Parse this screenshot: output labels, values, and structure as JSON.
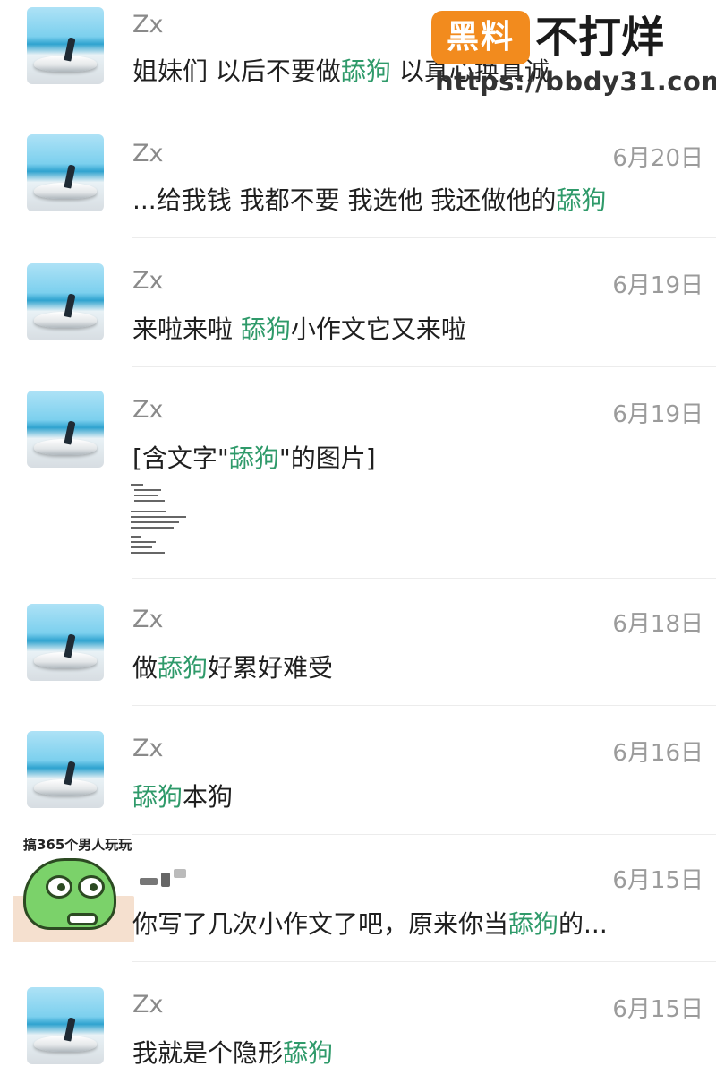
{
  "conversations": [
    {
      "name": "Zx",
      "date": "",
      "pre": "姐妹们 以后不要做",
      "kw": "舔狗",
      "post": " 以真心换真诚"
    },
    {
      "name": "Zx",
      "date": "6月20日",
      "pre": "...给我钱 我都不要 我选他 我还做他的",
      "kw": "舔狗",
      "post": ""
    },
    {
      "name": "Zx",
      "date": "6月19日",
      "pre": "来啦来啦 ",
      "kw": "舔狗",
      "post": "小作文它又来啦"
    },
    {
      "name": "Zx",
      "date": "6月19日",
      "pre": "[含文字\"",
      "kw": "舔狗",
      "post": "\"的图片]"
    },
    {
      "name": "Zx",
      "date": "6月18日",
      "pre": "做",
      "kw": "舔狗",
      "post": "好累好难受"
    },
    {
      "name": "Zx",
      "date": "6月16日",
      "pre": "",
      "kw": "舔狗",
      "post": "本狗"
    },
    {
      "name": "",
      "date": "6月15日",
      "pre": "你写了几次小作文了吧，原来你当",
      "kw": "舔狗",
      "post": "的..."
    },
    {
      "name": "Zx",
      "date": "6月15日",
      "pre": "我就是个隐形",
      "kw": "舔狗",
      "post": ""
    }
  ],
  "sticker": {
    "caption": "搞365个男人玩玩"
  },
  "watermark": {
    "badge": "黑料",
    "title": "不打烊",
    "url": "https://bbdy31.com"
  },
  "colors": {
    "keyword": "#2f9a6a",
    "watermark_badge": "#f28b1e"
  }
}
